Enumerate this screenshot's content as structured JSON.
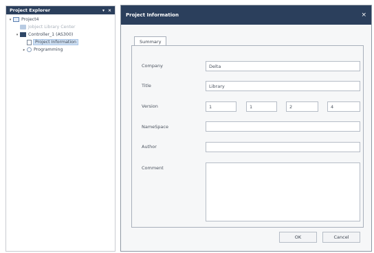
{
  "explorer": {
    "title": "Project Explorer",
    "pin_glyph": "▾",
    "close_glyph": "×",
    "tree": [
      {
        "label": "Project4",
        "toggle": "▾",
        "icon": "folder-icon"
      },
      {
        "label": "Jobject Library Center",
        "toggle": "",
        "icon": "library-icon"
      },
      {
        "label": "Controller_1 (AS300)",
        "toggle": "▾",
        "icon": "controller-icon"
      },
      {
        "label": "Project Information",
        "toggle": "",
        "icon": "document-icon"
      },
      {
        "label": "Programming",
        "toggle": "▸",
        "icon": "programming-icon"
      }
    ]
  },
  "dialog": {
    "title": "Project Information",
    "close_glyph": "×",
    "tab": "Summary",
    "labels": {
      "company": "Company",
      "title": "Title",
      "version": "Version",
      "namespace": "NameSpace",
      "author": "Author",
      "comment": "Comment"
    },
    "values": {
      "company": "Delta",
      "title": "Library",
      "version": [
        "1",
        "1",
        "2",
        "4"
      ],
      "namespace": "",
      "author": "",
      "comment": ""
    },
    "buttons": {
      "ok": "OK",
      "cancel": "Cancel"
    }
  },
  "colors": {
    "titlebar": "#2b3f5c",
    "selection": "#cfe0f3"
  }
}
